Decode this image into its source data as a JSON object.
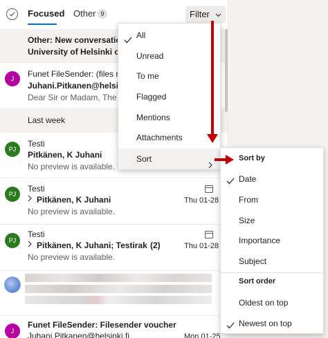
{
  "tabs": {
    "focused": "Focused",
    "other": "Other",
    "other_count": "9"
  },
  "filter": {
    "label": "Filter"
  },
  "messages": {
    "m1": {
      "line1": "Other: New conversations",
      "line2": "University of Helsinki on T"
    },
    "m2": {
      "avatar": "J",
      "line1": "Funet FileSender: (files no",
      "line2": "Juhani.Pitkanen@helsinki.",
      "line3": "Dear Sir or Madam, The fil"
    },
    "group": "Last week",
    "m3": {
      "avatar": "PJ",
      "line1": "Testi",
      "line2": "Pitkänen, K Juhani",
      "line3": "No preview is available."
    },
    "m4": {
      "avatar": "PJ",
      "line1": "Testi",
      "line2": "Pitkänen, K Juhani",
      "date": "Thu 01-28",
      "line3": "No preview is available."
    },
    "m5": {
      "avatar": "PJ",
      "line1": "Testi",
      "line2": "Pitkänen, K Juhani; Testirake...",
      "count": "(2)",
      "date": "Thu 01-28",
      "line3": "No preview is available."
    },
    "m7": {
      "avatar": "J",
      "line1": "Funet FileSender: Filesender voucher",
      "line2": "Juhani.Pitkanen@helsinki.fi",
      "date": "Mon 01-25"
    }
  },
  "filter_menu": {
    "all": "All",
    "unread": "Unread",
    "to_me": "To me",
    "flagged": "Flagged",
    "mentions": "Mentions",
    "attachments": "Attachments",
    "sort": "Sort"
  },
  "sort_menu": {
    "sort_by": "Sort by",
    "date": "Date",
    "from": "From",
    "size": "Size",
    "importance": "Importance",
    "subject": "Subject",
    "sort_order": "Sort order",
    "oldest": "Oldest on top",
    "newest": "Newest on top"
  },
  "colors": {
    "accent": "#0f6cbd",
    "annotation_arrow": "#c00000",
    "avatar_pj": "#2b7a1f",
    "avatar_j": "#b4009e"
  },
  "icons": [
    "select-all-circle",
    "chevron-down",
    "checkmark",
    "chevron-right",
    "calendar-icon"
  ]
}
